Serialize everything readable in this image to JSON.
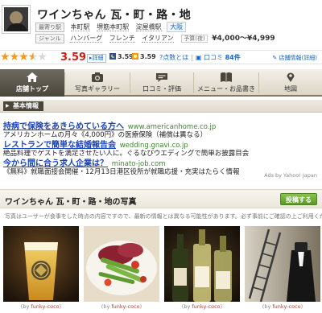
{
  "header": {
    "title": "ワインちゃん 瓦・町・路・地",
    "row1": {
      "label": "最寄り駅",
      "items": [
        "本町駅",
        "堺筋本町駅",
        "淀屋橋駅"
      ],
      "area": "大阪"
    },
    "row2": {
      "label": "ジャンル",
      "items": [
        "ハンバーグ",
        "フレンチ",
        "イタリアン"
      ],
      "price_label": "予算(夜)",
      "price": "¥4,000～¥4,999"
    }
  },
  "rating": {
    "score": "3.59",
    "stars_value": 3.59,
    "detail_label": "詳細",
    "dinner": "3.59",
    "lunch": "3.59",
    "points_label": "点数とは",
    "reviews_label": "口コミ",
    "reviews_count": "84件",
    "edit_label": "店舗情報(詳細)"
  },
  "tabs": [
    {
      "label": "店舗トップ",
      "icon": "home-icon"
    },
    {
      "label": "写真ギャラリー",
      "icon": "camera-icon"
    },
    {
      "label": "口コミ・評価",
      "icon": "chat-icon"
    },
    {
      "label": "メニュー・お品書き",
      "icon": "book-icon"
    },
    {
      "label": "地図",
      "icon": "map-pin-icon"
    }
  ],
  "basic_info_label": "基本情報",
  "ads": [
    {
      "title": "持病で保険をあきらめている方へ",
      "url": "www.americanhome.co.jp",
      "desc": "アメリカンホームの月々《4,000円》の医療保険（補償は異なる）"
    },
    {
      "title": "レストランで簡単な結婚報告会",
      "url": "wedding.gnavi.co.jp",
      "desc": "絶品料理でゲストを満足させたい人に。ぐるなびウエディングで簡単お披露目会"
    },
    {
      "title": "今から間に合う求人企業は？",
      "url": "minato-job.com",
      "desc": "《無料》就職面接会開催・12月13日港区役所が就職応援・充実はたらく情報"
    }
  ],
  "ads_by": "Ads by Yahoo! Japan",
  "photos": {
    "title": "ワインちゃん 瓦・町・路・地の写真",
    "post_label": "投稿する",
    "note": "写真はユーザーが食事をした時点の内容ですので、最新の情報とは異なる可能性があります。必ず事前にご確認の上ご利用ください。",
    "credit_prefix": "(by",
    "credit_user": "funky-coco",
    "credit_suffix": ")"
  },
  "colors": {
    "score_red": "#d21c1c",
    "link_blue": "#1a43b8",
    "url_green": "#3a8a2a",
    "star_orange": "#f29a17",
    "tab_active": "#4b463c",
    "post_green": "#5a9a2a"
  }
}
